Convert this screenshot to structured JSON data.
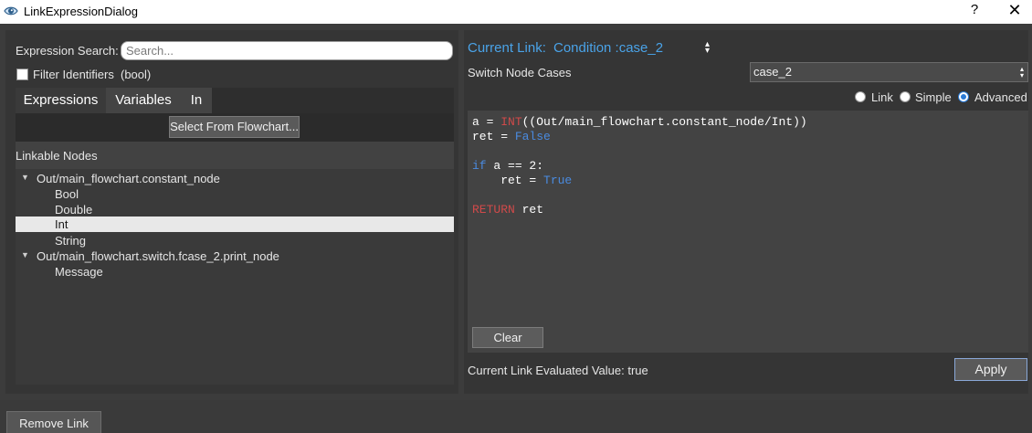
{
  "window": {
    "title": "LinkExpressionDialog",
    "help": "?",
    "close": "✕"
  },
  "left": {
    "search_label": "Expression Search:",
    "search_placeholder": "Search...",
    "filter_label": "Filter Identifiers",
    "filter_type": "(bool)",
    "filter_checked": false,
    "tabs": [
      {
        "label": "Expressions",
        "active": true
      },
      {
        "label": "Variables",
        "active": false
      },
      {
        "label": "In",
        "active": false
      }
    ],
    "select_button": "Select From Flowchart...",
    "tree_header": "Linkable Nodes",
    "tree": [
      {
        "label": "Out/main_flowchart.constant_node",
        "level": 0,
        "expanded": true
      },
      {
        "label": "Bool",
        "level": 1
      },
      {
        "label": "Double",
        "level": 1
      },
      {
        "label": "Int",
        "level": 1,
        "selected": true
      },
      {
        "label": "String",
        "level": 1
      },
      {
        "label": "Out/main_flowchart.switch.fcase_2.print_node",
        "level": 0,
        "expanded": true
      },
      {
        "label": "Message",
        "level": 1
      }
    ]
  },
  "right": {
    "current_link_label": "Current Link:",
    "current_link_value": "Condition :case_2",
    "switch_cases_label": "Switch Node Cases",
    "switch_cases_value": "case_2",
    "modes": [
      {
        "label": "Link",
        "checked": false
      },
      {
        "label": "Simple",
        "checked": false
      },
      {
        "label": "Advanced",
        "checked": true
      }
    ],
    "code": {
      "line1_var": "a = ",
      "line1_fn": "INT",
      "line1_rest": "((Out/main_flowchart.constant_node/Int))",
      "line2_var": "ret = ",
      "line2_val": "False",
      "line4_kw": "if",
      "line4_rest": " a == 2:",
      "line5_var": "    ret = ",
      "line5_val": "True",
      "line7_kw": "RETURN",
      "line7_rest": " ret"
    },
    "clear_button": "Clear",
    "evaluated_label": "Current Link Evaluated Value: true",
    "apply_button": "Apply"
  },
  "footer": {
    "remove_button": "Remove Link"
  },
  "colors": {
    "accent": "#4aa3e8",
    "keyword_blue": "#4a8be0",
    "keyword_red": "#d04a4a",
    "panel": "#353535",
    "background": "#3c3c3c"
  }
}
